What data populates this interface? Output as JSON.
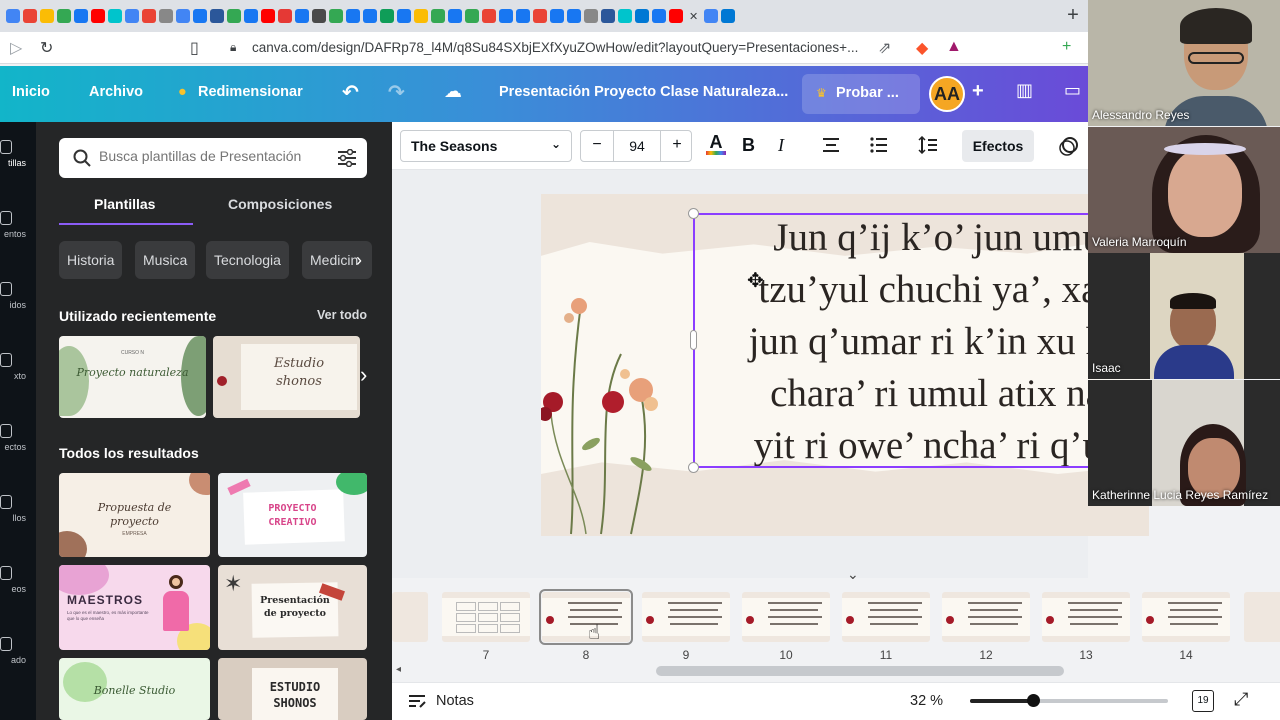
{
  "browser": {
    "url": "canva.com/design/DAFRp78_l4M/q8Su84SXbjEXfXyuZOwHow/edit?layoutQuery=Presentaciones+...",
    "tab_colors": [
      "#4285f4",
      "#ea4335",
      "#fbbc05",
      "#34a853",
      "#1877f2",
      "#ff0000",
      "#00c4cc",
      "#4285f4",
      "#ea4335",
      "#888888",
      "#4285f4",
      "#1877f2",
      "#2b579a",
      "#34a853",
      "#1877f2",
      "#ff0000",
      "#e53935",
      "#1877f2",
      "#4a4a4a",
      "#34a853",
      "#1877f2",
      "#1877f2",
      "#0f9d58",
      "#1877f2",
      "#fbbc05",
      "#34a853",
      "#1877f2",
      "#34a853",
      "#ea4335",
      "#1877f2",
      "#1877f2",
      "#ea4335",
      "#1877f2",
      "#1877f2",
      "#888888",
      "#2b579a",
      "#00c4cc",
      "#0078d4",
      "#1877f2",
      "#ff0000",
      "#4285f4",
      "#0078d4"
    ]
  },
  "header": {
    "home": "Inicio",
    "file": "Archivo",
    "resize": "Redimensionar",
    "title": "Presentación Proyecto Clase Naturaleza...",
    "try_pro": "Probar ...",
    "avatar": "AA"
  },
  "rail": {
    "items": [
      "tillas",
      "entos",
      "idos",
      "xto",
      "ectos",
      "llos",
      "eos",
      "ado"
    ]
  },
  "panel": {
    "search_placeholder": "Busca plantillas de Presentación",
    "tabs": [
      "Plantillas",
      "Composiciones"
    ],
    "chips": [
      "Historia",
      "Musica",
      "Tecnologia",
      "Medicin"
    ],
    "recent_title": "Utilizado recientemente",
    "see_all": "Ver todo",
    "recent": [
      {
        "line1": "CURSO N",
        "line2": "Proyecto naturaleza"
      },
      {
        "line1": "Estudio",
        "line2": "shonos"
      }
    ],
    "all_title": "Todos los resultados",
    "results": [
      {
        "line1": "Propuesta de",
        "line2": "proyecto",
        "line3": "EMPRESA"
      },
      {
        "line1": "PROYECTO",
        "line2": "CREATIVO"
      },
      {
        "line1": "MAESTROS",
        "line2": "Lo que es el maestro, es más importante que lo que enseña"
      },
      {
        "line1": "Presentación",
        "line2": "de proyecto"
      },
      {
        "line1": "Bonelle Studio",
        "line2": ""
      },
      {
        "line1": "ESTUDIO",
        "line2": "SHONOS"
      }
    ]
  },
  "toolbar": {
    "font": "The Seasons",
    "size": "94",
    "effects": "Efectos"
  },
  "slide": {
    "lines": [
      "Jun q’ij k’o’ jun umul",
      "tzu’yul chuchi ya’, xa p",
      "jun q’umar ri k’in xu k’u",
      "chara’ ri umul atix na’",
      "yit ri owe’ ncha’ ri q’um"
    ]
  },
  "participants": [
    {
      "name": "Alessandro Reyes",
      "bg": "#8a8478",
      "face": "#c89a78"
    },
    {
      "name": "Valeria  Marroquín",
      "bg": "#5b4a45",
      "face": "#d8a890"
    },
    {
      "name": "Isaac",
      "bg": "#d8d2c0",
      "face": "#9a6a50"
    },
    {
      "name": "Katherinne Lucia Reyes Ramírez",
      "bg": "#d9d6cf",
      "face": "#c08a70"
    }
  ],
  "filmstrip": {
    "pages": [
      "7",
      "8",
      "9",
      "10",
      "11",
      "12",
      "13",
      "14"
    ]
  },
  "bottom": {
    "notes": "Notas",
    "zoom": "32 %",
    "zoom_fraction": 0.32,
    "pages_count": "19"
  }
}
